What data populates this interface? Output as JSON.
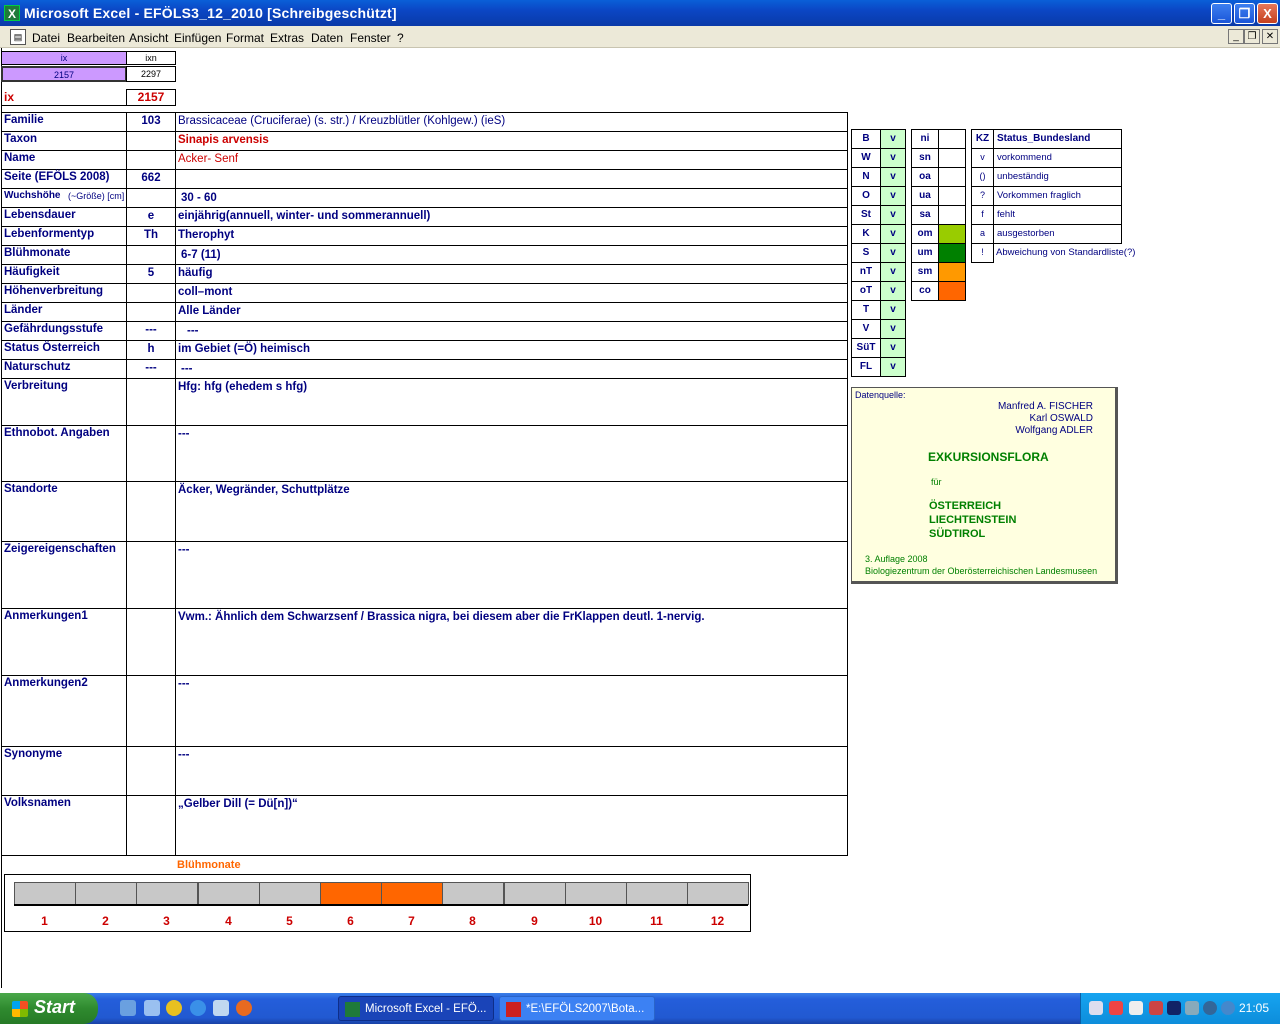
{
  "window": {
    "title": "Microsoft Excel - EFÖLS3_12_2010  [Schreibgeschützt]",
    "app_icon": "excel-icon",
    "buttons": [
      "_",
      "❐",
      "X"
    ]
  },
  "menu": {
    "items": [
      "Datei",
      "Bearbeiten",
      "Ansicht",
      "Einfügen",
      "Format",
      "Extras",
      "Daten",
      "Fenster",
      "?"
    ]
  },
  "index": {
    "ix_header": "ix",
    "ixn_header": "ixn",
    "ix_value": "2157",
    "ixn_value": "2297",
    "ix_label": "ix",
    "ix_big": "2157"
  },
  "record": {
    "familie": {
      "label": "Familie",
      "code": "103",
      "value": "Brassicaceae (Cruciferae) (s. str.)  /  Kreuzblütler (Kohlgew.) (ieS)"
    },
    "taxon": {
      "label": "Taxon",
      "code": "",
      "value": "Sinapis arvensis"
    },
    "name": {
      "label": "Name",
      "code": "",
      "value": "Acker- Senf"
    },
    "seite": {
      "label": "Seite (EFÖLS 2008)",
      "code": "662",
      "value": ""
    },
    "wuchshoehe": {
      "label": "Wuchshöhe",
      "label_suffix": "(~Größe) [cm]",
      "code": "",
      "value": "30 - 60"
    },
    "lebensdauer": {
      "label": "Lebensdauer",
      "code": "e",
      "value": "einjährig(annuell, winter- und sommerannuell)"
    },
    "lebensformentyp": {
      "label": "Lebenformentyp",
      "code": "Th",
      "value": "Therophyt"
    },
    "bluehmonate": {
      "label": "Blühmonate",
      "code": "",
      "value": "6-7 (11)"
    },
    "haeufigkeit": {
      "label": "Häufigkeit",
      "code": "5",
      "value": "häufig"
    },
    "hoehenverbreitung": {
      "label": "Höhenverbreitung",
      "code": "",
      "value": "coll–mont"
    },
    "laender": {
      "label": "Länder",
      "code": "",
      "value": "Alle Länder"
    },
    "gefaehrdung": {
      "label": "Gefährdungsstufe",
      "code": "---",
      "value": "---"
    },
    "status": {
      "label": "Status Österreich",
      "code": "h",
      "value": "im Gebiet (=Ö) heimisch"
    },
    "naturschutz": {
      "label": "Naturschutz",
      "code": "---",
      "value": "---"
    },
    "verbreitung": {
      "label": "Verbreitung",
      "value": "Hfg: hfg (ehedem s hfg)"
    },
    "ethnobot": {
      "label": "Ethnobot. Angaben",
      "value": "---"
    },
    "standorte": {
      "label": "Standorte",
      "value": "Äcker, Wegränder, Schuttplätze"
    },
    "zeiger": {
      "label": "Zeigereigenschaften",
      "value": "---"
    },
    "anm1": {
      "label": "Anmerkungen1",
      "value": "Vwm.: Ähnlich dem Schwarzsenf / Brassica nigra, bei diesem aber die FrKlappen deutl. 1-nervig."
    },
    "anm2": {
      "label": "Anmerkungen2",
      "value": "---"
    },
    "synonyme": {
      "label": "Synonyme",
      "value": "---"
    },
    "volksnamen": {
      "label": "Volksnamen",
      "value": "„Gelber Dill (= Dü[n])“"
    }
  },
  "states": {
    "codes": [
      "B",
      "W",
      "N",
      "O",
      "St",
      "K",
      "S",
      "nT",
      "oT",
      "T",
      "V",
      "SüT",
      "FL"
    ],
    "values": [
      "v",
      "v",
      "v",
      "v",
      "v",
      "v",
      "v",
      "v",
      "v",
      "v",
      "v",
      "v",
      "v"
    ]
  },
  "altitude": {
    "codes": [
      "ni",
      "sn",
      "oa",
      "ua",
      "sa",
      "om",
      "um",
      "sm",
      "co"
    ],
    "colors": [
      "#ffffff",
      "#ffffff",
      "#ffffff",
      "#ffffff",
      "#ffffff",
      "#99cc00",
      "#008000",
      "#ff9900",
      "#ff6600"
    ]
  },
  "status_legend": {
    "kz_header": "KZ",
    "title": "Status_Bundesland",
    "items": [
      {
        "kz": "v",
        "text": "vorkommend"
      },
      {
        "kz": "()",
        "text": "unbeständig"
      },
      {
        "kz": "?",
        "text": "Vorkommen fraglich"
      },
      {
        "kz": "f",
        "text": "fehlt"
      },
      {
        "kz": "a",
        "text": "ausgestorben"
      },
      {
        "kz": "!",
        "text": "Abweichung von Standardliste(?)"
      }
    ]
  },
  "datenquelle": {
    "heading": "Datenquelle:",
    "authors": [
      "Manfred A. FISCHER",
      "Karl OSWALD",
      "Wolfgang ADLER"
    ],
    "book": "EXKURSIONSFLORA",
    "fuer": "für",
    "regions": [
      "ÖSTERREICH",
      "LIECHTENSTEIN",
      "SÜDTIROL"
    ],
    "edition": "3. Auflage 2008",
    "publisher": "Biologiezentrum der Oberösterreichischen Landesmuseen"
  },
  "bloom": {
    "title": "Blühmonate",
    "months": [
      "1",
      "2",
      "3",
      "4",
      "5",
      "6",
      "7",
      "8",
      "9",
      "10",
      "11",
      "12"
    ],
    "active": [
      false,
      false,
      false,
      false,
      false,
      true,
      true,
      false,
      false,
      false,
      false,
      false
    ],
    "active_color": "#ff6600",
    "inactive_color": "#c8c8c8"
  },
  "taskbar": {
    "start": "Start",
    "tasks": [
      "Microsoft Excel - EFÖ...",
      "*E:\\EFÖLS2007\\Bota..."
    ],
    "clock": "21:05"
  }
}
